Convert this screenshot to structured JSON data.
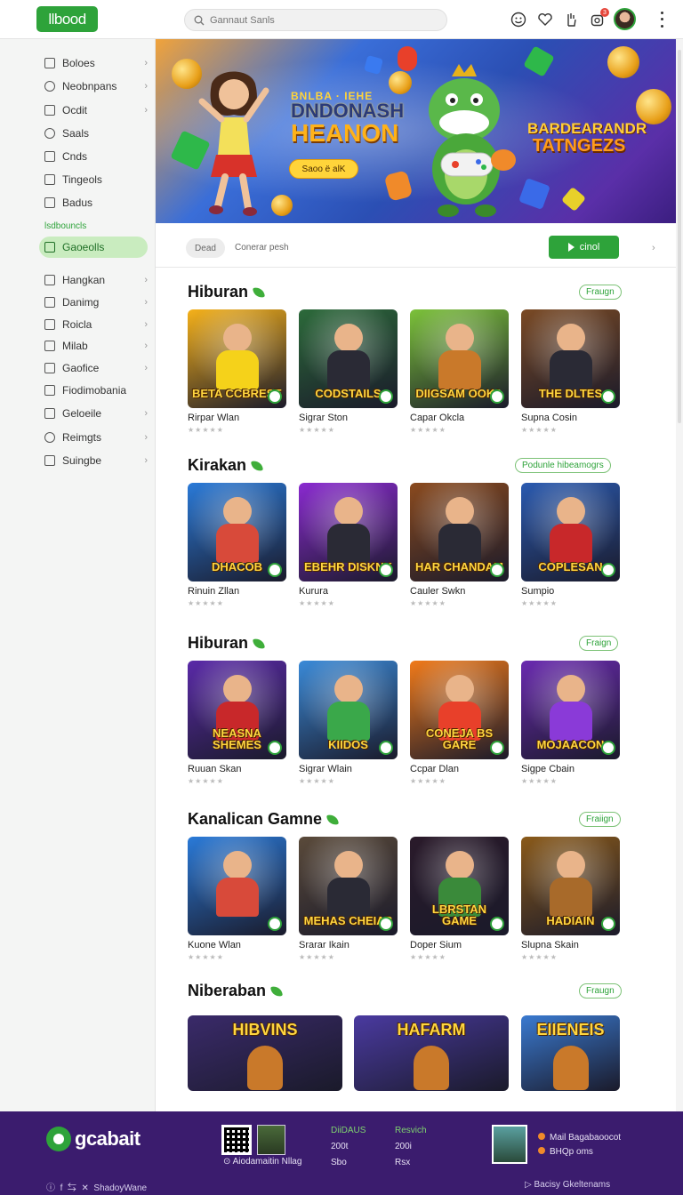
{
  "header": {
    "logo_text": "llbood",
    "search_placeholder": "Gannaut Sanls",
    "notif_count": "3",
    "icons": [
      "smiley-icon",
      "heart-icon",
      "hand-icon",
      "notification-icon",
      "avatar",
      "more-icon"
    ]
  },
  "sidebar": {
    "items": [
      {
        "label": "Boloes",
        "icon": "box-icon",
        "chevron": true
      },
      {
        "label": "Neobnpans",
        "icon": "circle-icon",
        "chevron": true
      },
      {
        "label": "Ocdit",
        "icon": "home-icon",
        "chevron": true
      },
      {
        "label": "Saals",
        "icon": "search-icon",
        "chevron": false
      },
      {
        "label": "Cnds",
        "icon": "folder-icon",
        "chevron": false
      },
      {
        "label": "Tingeols",
        "icon": "document-icon",
        "chevron": false
      },
      {
        "label": "Badus",
        "icon": "trash-icon",
        "chevron": false
      }
    ],
    "group_label": "lsdbouncls",
    "active_item": {
      "label": "Gaoeolls",
      "icon": "image-icon"
    },
    "items2": [
      {
        "label": "Hangkan",
        "icon": "box-icon",
        "chevron": true
      },
      {
        "label": "Danimg",
        "icon": "grid-icon",
        "chevron": true
      },
      {
        "label": "Roicla",
        "icon": "box-icon",
        "chevron": true
      },
      {
        "label": "Milab",
        "icon": "box-icon",
        "chevron": true
      },
      {
        "label": "Gaofice",
        "icon": "box-icon",
        "chevron": true
      },
      {
        "label": "Fiodimobania",
        "icon": "box-icon",
        "chevron": false
      },
      {
        "label": "Geloeile",
        "icon": "home-icon",
        "chevron": true
      },
      {
        "label": "Reimgts",
        "icon": "circle-icon",
        "chevron": true
      },
      {
        "label": "Suingbe",
        "icon": "image-icon",
        "chevron": true
      }
    ]
  },
  "hero": {
    "line1": "BNLBA · IEHE",
    "line2": "DNDONASH",
    "line3": "HEANON",
    "cta": "Saoo ë alK",
    "badge_line1": "BARDEARANDR",
    "badge_line2": "TATNGEZS"
  },
  "filters": {
    "chip": "Dead",
    "path": "Conerar pesh",
    "play": "cinol"
  },
  "sections": [
    {
      "title": "Hiburan",
      "more": "Fraugn",
      "cards": [
        {
          "name": "Rirpar Wlan",
          "thumb_title": "BETA CCBRESE",
          "bg": "#f5b11a",
          "char": "#f5d21a"
        },
        {
          "name": "Sigrar Ston",
          "thumb_title": "CODSTAILS",
          "bg": "#2c6a3a",
          "char": "#2a2a35"
        },
        {
          "name": "Capar Okcla",
          "thumb_title": "DIIGSAM OOKA",
          "bg": "#7cc23a",
          "char": "#c9792a"
        },
        {
          "name": "Supna Cosin",
          "thumb_title": "THE DLTES",
          "bg": "#7a4a25",
          "char": "#2a2a35"
        }
      ]
    },
    {
      "title": "Kirakan",
      "more": "Podunle hibeamogrs",
      "cards": [
        {
          "name": "Rinuin Zllan",
          "thumb_title": "DHACOB",
          "bg": "#2a7ad8",
          "char": "#d84a3a"
        },
        {
          "name": "Kurura",
          "thumb_title": "EBEHR DISKNK",
          "bg": "#8a2ad0",
          "char": "#2a2a35"
        },
        {
          "name": "Cauler Swkn",
          "thumb_title": "HAR CHANDAM",
          "bg": "#8a4a1e",
          "char": "#2a2a35"
        },
        {
          "name": "Sumpio",
          "thumb_title": "COPLESAN",
          "bg": "#2a5ab0",
          "char": "#c8282a"
        }
      ]
    },
    {
      "title": "Hiburan",
      "more": "Fraign",
      "cards": [
        {
          "name": "Ruuan Skan",
          "thumb_title": "NEASNA SHEMES",
          "bg": "#5a2aa8",
          "char": "#c8282a"
        },
        {
          "name": "Sigrar Wlain",
          "thumb_title": "KIIDOS",
          "bg": "#3a8ad8",
          "char": "#3aa84a"
        },
        {
          "name": "Ccpar Dlan",
          "thumb_title": "CONEJA BS GARE",
          "bg": "#f07a1a",
          "char": "#e8402a"
        },
        {
          "name": "Sigpe Cbain",
          "thumb_title": "MOJAACON",
          "bg": "#6a2ab0",
          "char": "#8a3ad8"
        }
      ]
    },
    {
      "title": "Kanalican Gamne",
      "more": "Fraiign",
      "cards": [
        {
          "name": "Kuone Wlan",
          "thumb_title": "",
          "bg": "#2a7ad8",
          "char": "#d84a3a"
        },
        {
          "name": "Srarar Ikain",
          "thumb_title": "MEHAS CHEIAS",
          "bg": "#5a4a3a",
          "char": "#2a2a35"
        },
        {
          "name": "Doper Sium",
          "thumb_title": "LBRSTAN GAME",
          "bg": "#2a1a2a",
          "char": "#3a8a3a"
        },
        {
          "name": "Slupna Skain",
          "thumb_title": "HADIAIN",
          "bg": "#8a5a1a",
          "char": "#a86a2a"
        }
      ]
    },
    {
      "title": "Niberaban",
      "more": "Fraugn",
      "wide": [
        {
          "thumb_title": "HIBVINS",
          "bg": "#3a2a6a"
        },
        {
          "thumb_title": "HAFARM",
          "bg": "#4a3aa0"
        },
        {
          "thumb_title": "EIIENEIS",
          "bg": "#3a7ad0"
        }
      ]
    }
  ],
  "footer": {
    "brand": "gcabait",
    "qr_note": "Aiodamaitin Nllag",
    "col1": {
      "head": "DiiDAUS",
      "l1": "200t",
      "l2": "Sbo"
    },
    "col2": {
      "head": "Resvich",
      "l1": "200i",
      "l2": "Rsx"
    },
    "links": [
      "Mail Bagabaoocot",
      "BHQp oms"
    ],
    "bottom_left": "ShadoyWane",
    "bottom_right": "Bacisy  Gkeltenams"
  },
  "colors": {
    "accent": "#2ea33a",
    "footer_bg": "#3b1c6e"
  }
}
